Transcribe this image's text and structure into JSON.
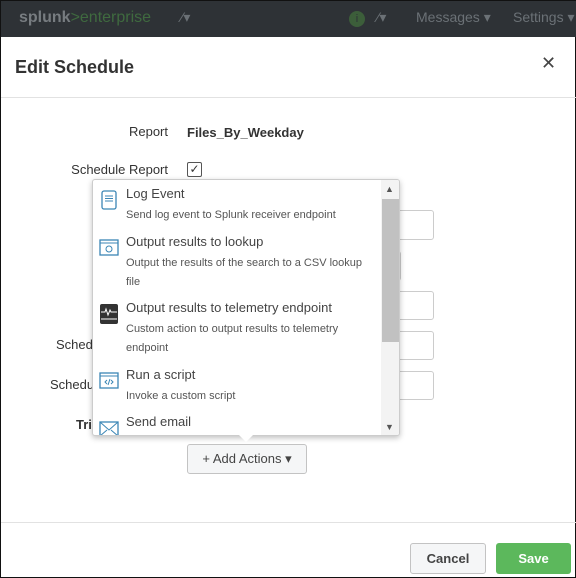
{
  "topbar": {
    "logo_main": "splunk",
    "logo_sep": ">",
    "logo_sub": "enterprise",
    "info_badge": "i",
    "messages": "Messages ▾",
    "settings": "Settings ▾",
    "activity_icon": "⁄▾"
  },
  "modal": {
    "title": "Edit Schedule",
    "close": "✕"
  },
  "form": {
    "report_label": "Report",
    "report_value": "Files_By_Weekday",
    "schedule_label": "Schedule Report",
    "schedule_checked": true,
    "check": "✓",
    "partial_labels": [
      "Sched",
      "Schedu",
      "Tri"
    ]
  },
  "actions_menu": {
    "items": [
      {
        "title": "Log Event",
        "desc": "Send log event to Splunk receiver endpoint",
        "icon": "log-icon"
      },
      {
        "title": "Output results to lookup",
        "desc": "Output the results of the search to a CSV lookup file",
        "icon": "lookup-icon"
      },
      {
        "title": "Output results to telemetry endpoint",
        "desc": "Custom action to output results to telemetry endpoint",
        "icon": "telemetry-icon"
      },
      {
        "title": "Run a script",
        "desc": "Invoke a custom script",
        "icon": "script-icon"
      },
      {
        "title": "Send email",
        "desc": "",
        "icon": "email-icon"
      }
    ]
  },
  "add_actions": "+ Add Actions ▾",
  "footer": {
    "cancel": "Cancel",
    "save": "Save"
  },
  "colors": {
    "accent": "#5cb85c",
    "icon_blue": "#3b86b5"
  }
}
